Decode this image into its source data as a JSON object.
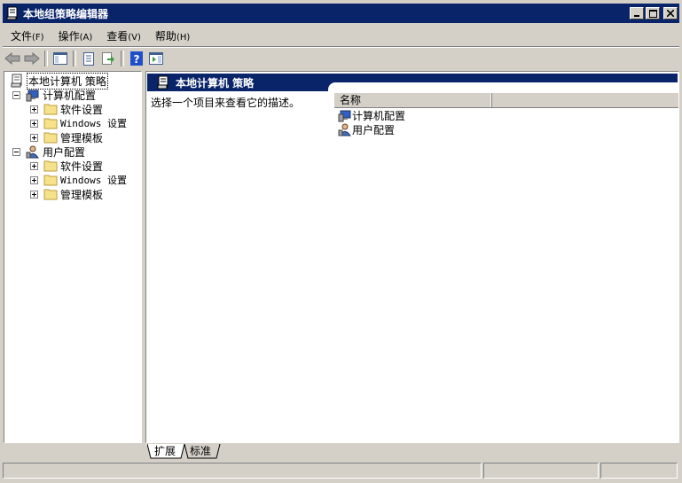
{
  "window": {
    "title": "本地组策略编辑器"
  },
  "menu": [
    {
      "label": "文件",
      "accel": "(F)"
    },
    {
      "label": "操作",
      "accel": "(A)"
    },
    {
      "label": "查看",
      "accel": "(V)"
    },
    {
      "label": "帮助",
      "accel": "(H)"
    }
  ],
  "tree": {
    "root": "本地计算机 策略",
    "computer_config": "计算机配置",
    "computer_children": [
      "软件设置",
      "Windows 设置",
      "管理模板"
    ],
    "user_config": "用户配置",
    "user_children": [
      "软件设置",
      "Windows 设置",
      "管理模板"
    ]
  },
  "details": {
    "header": "本地计算机 策略",
    "description": "选择一个项目来查看它的描述。",
    "column_name": "名称",
    "items": [
      "计算机配置",
      "用户配置"
    ]
  },
  "tabs": [
    "扩展",
    "标准"
  ],
  "colors": {
    "titlebar": "#0a246a",
    "chrome": "#d4d0c8"
  }
}
